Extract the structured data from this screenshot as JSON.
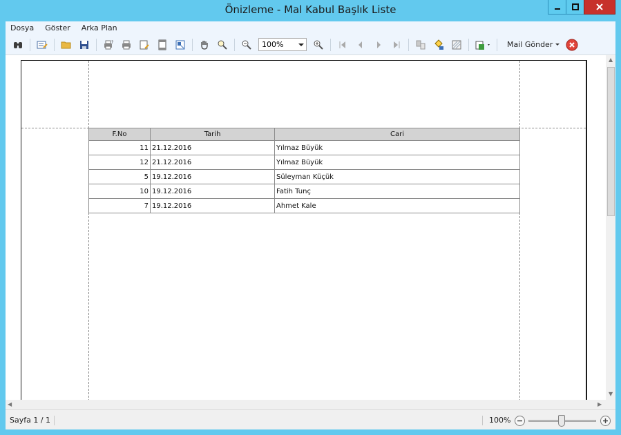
{
  "window": {
    "title": "Önizleme - Mal Kabul Başlık Liste"
  },
  "menu": {
    "items": [
      "Dosya",
      "Göster",
      "Arka Plan"
    ]
  },
  "toolbar": {
    "zoom_value": "100%",
    "mail_label": "Mail Gönder"
  },
  "report": {
    "columns": [
      "F.No",
      "Tarih",
      "Cari"
    ],
    "rows": [
      [
        "11",
        "21.12.2016",
        "Yılmaz Büyük"
      ],
      [
        "12",
        "21.12.2016",
        "Yılmaz Büyük"
      ],
      [
        "5",
        "19.12.2016",
        "Süleyman Küçük"
      ],
      [
        "10",
        "19.12.2016",
        "Fatih Tunç"
      ],
      [
        "7",
        "19.12.2016",
        "Ahmet Kale"
      ]
    ]
  },
  "status": {
    "page_label": "Sayfa 1 / 1",
    "zoom_label": "100%"
  },
  "colors": {
    "titlebar": "#62c9ee",
    "close_button": "#c7312b",
    "header_bg": "#d3d3d3"
  }
}
